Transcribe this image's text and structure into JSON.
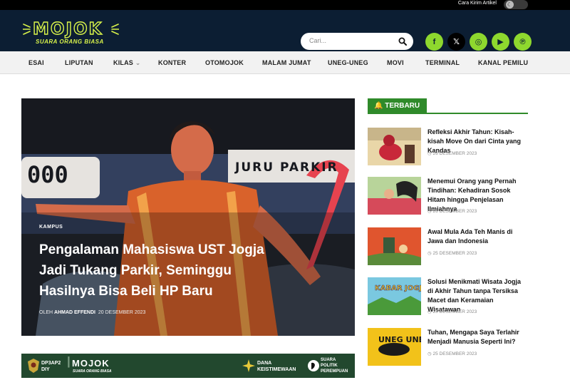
{
  "topbar": {
    "submit_link": "Cara Kirim Artikel",
    "toggle_icon": "moon-icon"
  },
  "header": {
    "logo_text": "MOJOK",
    "logo_tagline": "SUARA ORANG BIASA",
    "search_placeholder": "Cari...",
    "socials": [
      {
        "icon": "facebook-icon",
        "glyph": "f"
      },
      {
        "icon": "x-twitter-icon",
        "glyph": "𝕏"
      },
      {
        "icon": "instagram-icon",
        "glyph": "◎"
      },
      {
        "icon": "youtube-icon",
        "glyph": "▶"
      },
      {
        "icon": "pinterest-icon",
        "glyph": "℗"
      }
    ],
    "accent": "#8ed82e",
    "bg": "#0c1e33"
  },
  "nav": {
    "items": [
      "ESAI",
      "LIPUTAN",
      "KILAS",
      "KONTER",
      "OTOMOJOK",
      "MALAM JUMAT",
      "UNEG-UNEG",
      "MOVI",
      "TERMINAL",
      "KANAL PEMILU"
    ]
  },
  "hero": {
    "category": "KAMPUS",
    "title": "Pengalaman Mahasiswa UST Jogja Jadi Tukang Parkir, Seminggu Hasilnya Bisa Beli HP Baru",
    "by": "OLEH",
    "author": "AHMAD EFFENDI",
    "date": "20 DESEMBER 2023",
    "image_text_left": "000",
    "image_text_right": "JURU PARKIR"
  },
  "banner": {
    "org": "DP3AP2\nDIY",
    "logo": "MOJOK",
    "logo_tagline": "SUARA ORANG BIASA",
    "dana": "DANA\nKEISTIMEWAAN",
    "suara": "SUARA\nPOLITIK\nPEREMPUAN"
  },
  "sidebar": {
    "heading": "TERBARU",
    "posts": [
      {
        "title": "Refleksi Akhir Tahun: Kisah-kisah Move On dari Cinta yang Kandas",
        "date": "26 DESEMBER 2023"
      },
      {
        "title": "Menemui Orang yang Pernah Tindihan: Kehadiran Sosok Hitam hingga Penjelasan Ilmiahnya",
        "date": "26 DESEMBER 2023"
      },
      {
        "title": "Awal Mula Ada Teh Manis di Jawa dan Indonesia",
        "date": "25 DESEMBER 2023"
      },
      {
        "title": "Solusi Menikmati Wisata Jogja di Akhir Tahun tanpa Tersiksa Macet dan Keramaian Wisatawan",
        "date": "25 DESEMBER 2023"
      },
      {
        "title": "Tuhan, Mengapa Saya Terlahir Menjadi Manusia Seperti Ini?",
        "date": "25 DESEMBER 2023"
      }
    ],
    "thumb_texts": [
      "KABAR JOGJA",
      "UNEG UNEG"
    ]
  }
}
